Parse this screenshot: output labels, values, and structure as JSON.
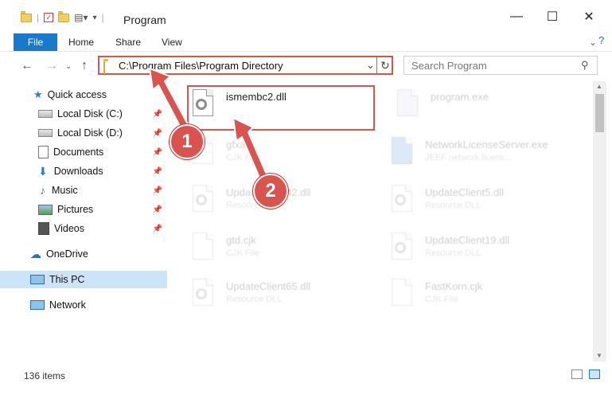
{
  "window": {
    "title": "Program",
    "minimize": "—",
    "maximize": "☐",
    "close": "✕"
  },
  "ribbon": {
    "tabs": [
      "File",
      "Home",
      "Share",
      "View"
    ]
  },
  "address": {
    "path": "C:\\Program Files\\Program Directory",
    "search_placeholder": "Search Program"
  },
  "sidebar": {
    "items": [
      {
        "label": "Quick access",
        "icon": "star-icon"
      },
      {
        "label": "Local Disk (C:)",
        "icon": "drive-icon",
        "pinned": true
      },
      {
        "label": "Local Disk (D:)",
        "icon": "drive-icon",
        "pinned": true
      },
      {
        "label": "Documents",
        "icon": "documents-icon",
        "pinned": true
      },
      {
        "label": "Downloads",
        "icon": "download-icon",
        "pinned": true
      },
      {
        "label": "Music",
        "icon": "music-icon",
        "pinned": true
      },
      {
        "label": "Pictures",
        "icon": "pictures-icon",
        "pinned": true
      },
      {
        "label": "Videos",
        "icon": "videos-icon",
        "pinned": true
      },
      {
        "label": "OneDrive",
        "icon": "cloud-icon"
      },
      {
        "label": "This PC",
        "icon": "computer-icon",
        "selected": true
      },
      {
        "label": "Network",
        "icon": "network-icon"
      }
    ]
  },
  "files": [
    {
      "name": "ismembc2.dll",
      "type": ""
    },
    {
      "name": "program.exe",
      "type": ""
    },
    {
      "name": "gfxapi",
      "type": "CJK File"
    },
    {
      "name": "NetworkLicenseServer.exe",
      "type": "JEEF network licens..."
    },
    {
      "name": "UpdateClient42.dll",
      "type": "Resource DLL"
    },
    {
      "name": "UpdateClient5.dll",
      "type": "Resource DLL"
    },
    {
      "name": "gtd.cjk",
      "type": "CJK File"
    },
    {
      "name": "UpdateClient19.dll",
      "type": "Resource DLL"
    },
    {
      "name": "UpdateClient65.dll",
      "type": "Resource DLL"
    },
    {
      "name": "FastKorn.cjk",
      "type": "CJK File"
    }
  ],
  "status": {
    "item_count": "136 items"
  },
  "callouts": [
    "1",
    "2"
  ],
  "colors": {
    "accent": "#1979ca",
    "annotation": "#d9534f",
    "selected": "#cce4f7"
  }
}
